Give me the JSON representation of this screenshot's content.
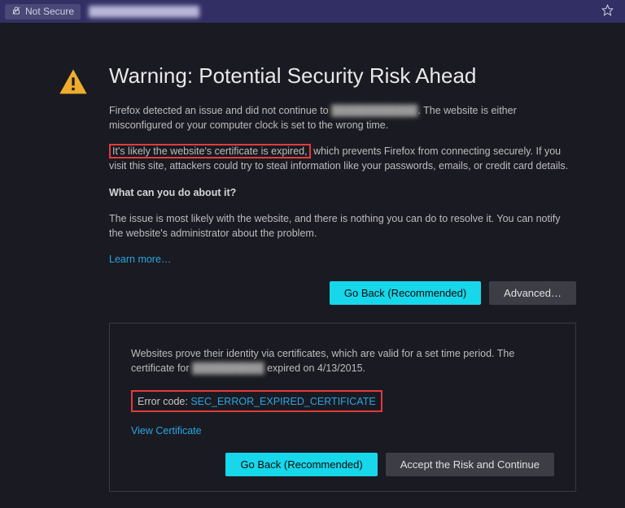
{
  "urlbar": {
    "not_secure": "Not Secure",
    "domain_placeholder": "████████████████"
  },
  "page": {
    "title": "Warning: Potential Security Risk Ahead",
    "intro_before": "Firefox detected an issue and did not continue to ",
    "intro_domain": "████████████",
    "intro_after": ". The website is either misconfigured or your computer clock is set to the wrong time.",
    "expired_highlight": "It's likely the website's certificate is expired,",
    "expired_rest": " which prevents Firefox from connecting securely. If you visit this site, attackers could try to steal information like your passwords, emails, or credit card details.",
    "what_heading": "What can you do about it?",
    "what_body": "The issue is most likely with the website, and there is nothing you can do to resolve it. You can notify the website's administrator about the problem.",
    "learn_more": "Learn more…",
    "go_back": "Go Back (Recommended)",
    "advanced": "Advanced…"
  },
  "advanced": {
    "cert_before": "Websites prove their identity via certificates, which are valid for a set time period. The certificate for ",
    "cert_domain": "██████████",
    "cert_after": " expired on 4/13/2015.",
    "error_label": "Error code: ",
    "error_code": "SEC_ERROR_EXPIRED_CERTIFICATE",
    "view_cert": "View Certificate",
    "go_back": "Go Back (Recommended)",
    "accept_risk": "Accept the Risk and Continue"
  }
}
